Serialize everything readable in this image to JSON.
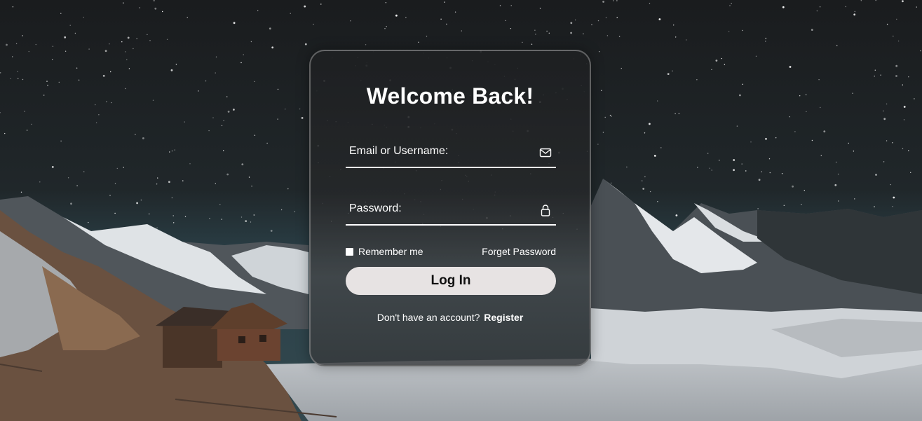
{
  "login_form": {
    "title": "Welcome Back!",
    "email_placeholder": "Email or Username:",
    "email_icon": "envelope-icon",
    "password_placeholder": "Password:",
    "password_icon": "lock-icon",
    "remember_label": "Remember me",
    "forget_label": "Forget Password",
    "login_label": "Log In",
    "register_prompt": "Don't have an account?",
    "register_label": "Register"
  },
  "colors": {
    "text": "#ffffff",
    "button_bg": "#e7e3e3",
    "button_text": "#111111"
  }
}
